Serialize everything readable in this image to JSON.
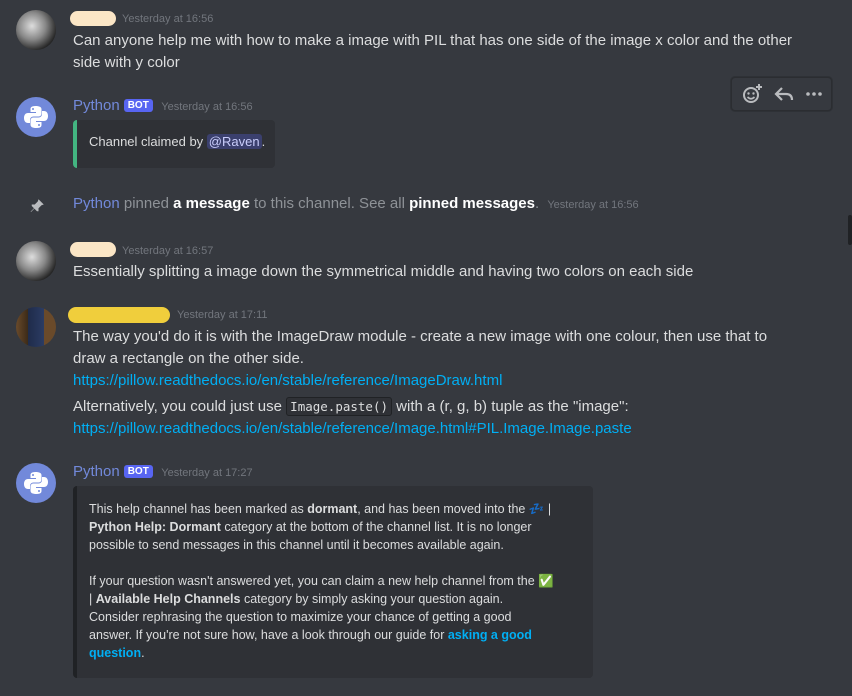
{
  "messages": {
    "m1": {
      "timestamp": "Yesterday at 16:56",
      "lines": [
        "Can anyone help me with how to make a image with PIL that has one side of the image x color and the other",
        "side with y color"
      ]
    },
    "m2": {
      "author": "Python",
      "tag": "BOT",
      "timestamp": "Yesterday at 16:56",
      "embed_prefix": "Channel claimed by ",
      "mention": "@Raven",
      "embed_suffix": "."
    },
    "pin": {
      "author": "Python",
      "pre": " pinned ",
      "msg_link": "a message",
      "mid": " to this channel. See all ",
      "pins_link": "pinned messages",
      "end": ".",
      "timestamp": "Yesterday at 16:56"
    },
    "m3": {
      "timestamp": "Yesterday at 16:57",
      "text": "Essentially splitting a image down the symmetrical middle and having two colors on each side"
    },
    "m4": {
      "timestamp": "Yesterday at 17:11",
      "line1": "The way you'd do it is with the ImageDraw module - create a new image with one colour, then use that to",
      "line2": "draw a rectangle on the other side.",
      "link1": "https://pillow.readthedocs.io/en/stable/reference/ImageDraw.html",
      "alt_pre": "Alternatively, you could just use ",
      "alt_code": "Image.paste()",
      "alt_post": " with a (r, g, b) tuple as the \"image\":",
      "link2": "https://pillow.readthedocs.io/en/stable/reference/Image.html#PIL.Image.Image.paste"
    },
    "m5": {
      "author": "Python",
      "tag": "BOT",
      "timestamp": "Yesterday at 17:27",
      "p1a": "This help channel has been marked as ",
      "p1b": "dormant",
      "p1c": ", and has been moved into the ",
      "zzz": "💤",
      "p1d": " | ",
      "p1e": "Python Help: Dormant",
      "p1f": " category at the bottom of the channel list. It is no longer",
      "p1g": "possible to send messages in this channel until it becomes available again.",
      "p2a": "If your question wasn't answered yet, you can claim a new help channel from the",
      "check": "✅",
      "p2b": " | ",
      "p2c": "Available Help Channels",
      "p2d": " category by simply asking your question again.",
      "p2e": "Consider rephrasing the question to maximize your chance of getting a good",
      "p2f": "answer. If you're not sure how, have a look through our guide for ",
      "p2link1": "asking a good",
      "p2link2": "question",
      "p2end": "."
    }
  },
  "colors": {
    "background": "#36393f",
    "bot_name": "#7289da",
    "link": "#00aff4",
    "embed_accent_green": "#43b581",
    "name_blob_1": "#fbe6c6",
    "name_blob_2": "#f0ce3c"
  },
  "icons": [
    "add-reaction-icon",
    "reply-icon",
    "more-icon",
    "pin-icon",
    "python-logo-icon"
  ]
}
